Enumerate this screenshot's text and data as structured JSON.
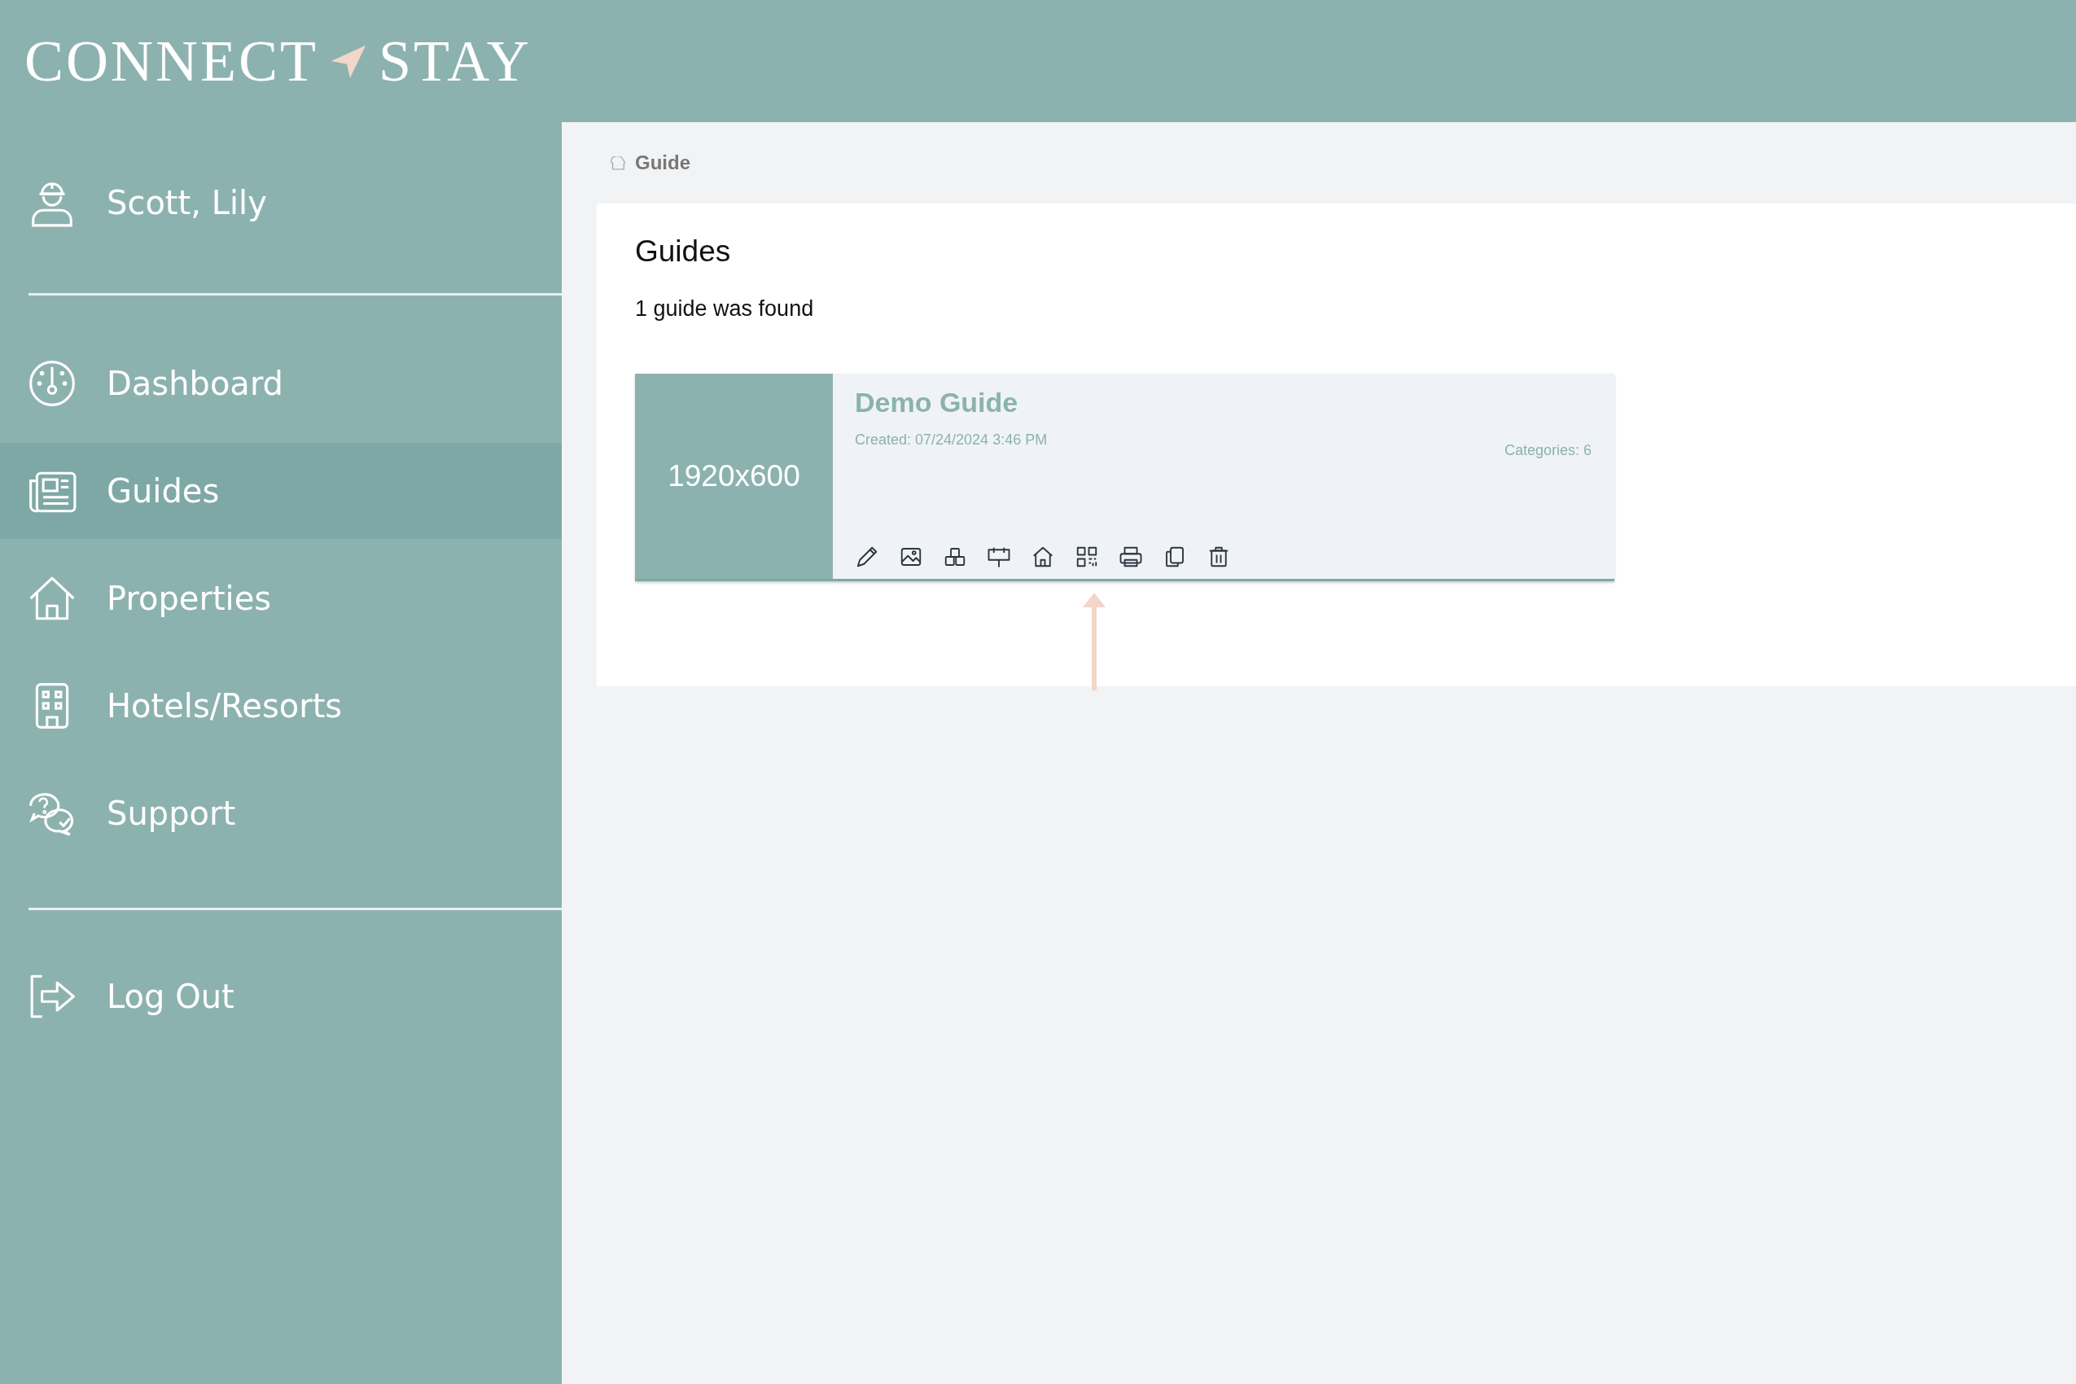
{
  "logo": {
    "left": "CONNECT",
    "right": "STAY"
  },
  "user": {
    "name": "Scott, Lily"
  },
  "nav": [
    {
      "label": "Dashboard",
      "selected": false
    },
    {
      "label": "Guides",
      "selected": true
    },
    {
      "label": "Properties",
      "selected": false
    },
    {
      "label": "Hotels/Resorts",
      "selected": false
    },
    {
      "label": "Support",
      "selected": false
    }
  ],
  "logout": {
    "label": "Log Out"
  },
  "breadcrumb": "Guide",
  "page": {
    "title": "Guides",
    "count_text": "1 guide was found"
  },
  "guides": [
    {
      "thumbnail": "1920x600",
      "title": "Demo Guide",
      "created": "Created: 07/24/2024 3:46 PM",
      "categories": "Categories: 6"
    }
  ]
}
